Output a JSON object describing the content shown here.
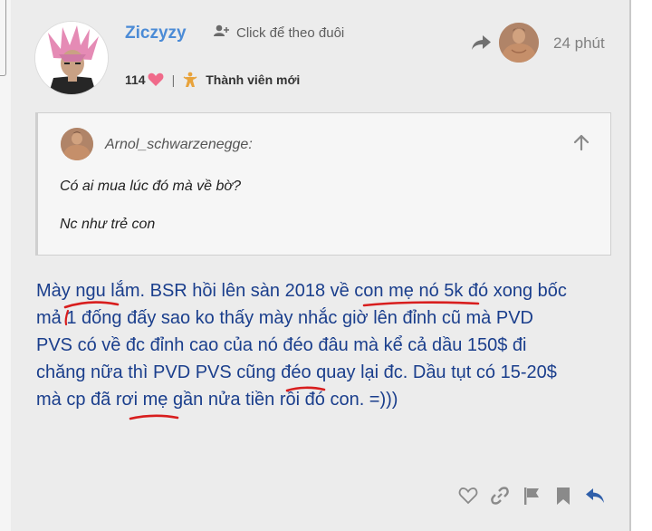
{
  "post": {
    "username": "Ziczyzy",
    "follow_label": "Click để theo đuôi",
    "time": "24 phút",
    "likes_count": "114",
    "rank": "Thành viên mới"
  },
  "quote": {
    "author": "Arnol_schwarzenegge:",
    "lines": [
      "Có ai mua lúc đó mà về bờ?",
      "Nc như trẻ con"
    ]
  },
  "body": {
    "lines": [
      "Mày ngu lắm. BSR hồi lên sàn 2018 về con mẹ nó 5k đó xong bốc",
      "mả 1 đống đấy sao ko thấy mày nhắc giờ lên đỉnh cũ mà PVD",
      "PVS có về đc đỉnh cao của nó đéo đâu mà kể cả dầu 150$ đi",
      "chăng nữa thì PVD PVS cũng đéo quay lại đc. Dầu tụt có 15-20$",
      "mà cp đã rơi mẹ gần nửa tiền rồi đó con. =)))"
    ]
  },
  "colors": {
    "accent": "#4b8bd6",
    "body_text": "#1a3e8c",
    "heart": "#f06a8a",
    "underline": "#d81e1e"
  },
  "icons": [
    "follow-icon",
    "reply-share-icon",
    "heart-icon",
    "member-icon",
    "arrow-up-icon",
    "like-outline-icon",
    "link-icon",
    "flag-icon",
    "bookmark-icon",
    "reply-icon"
  ]
}
